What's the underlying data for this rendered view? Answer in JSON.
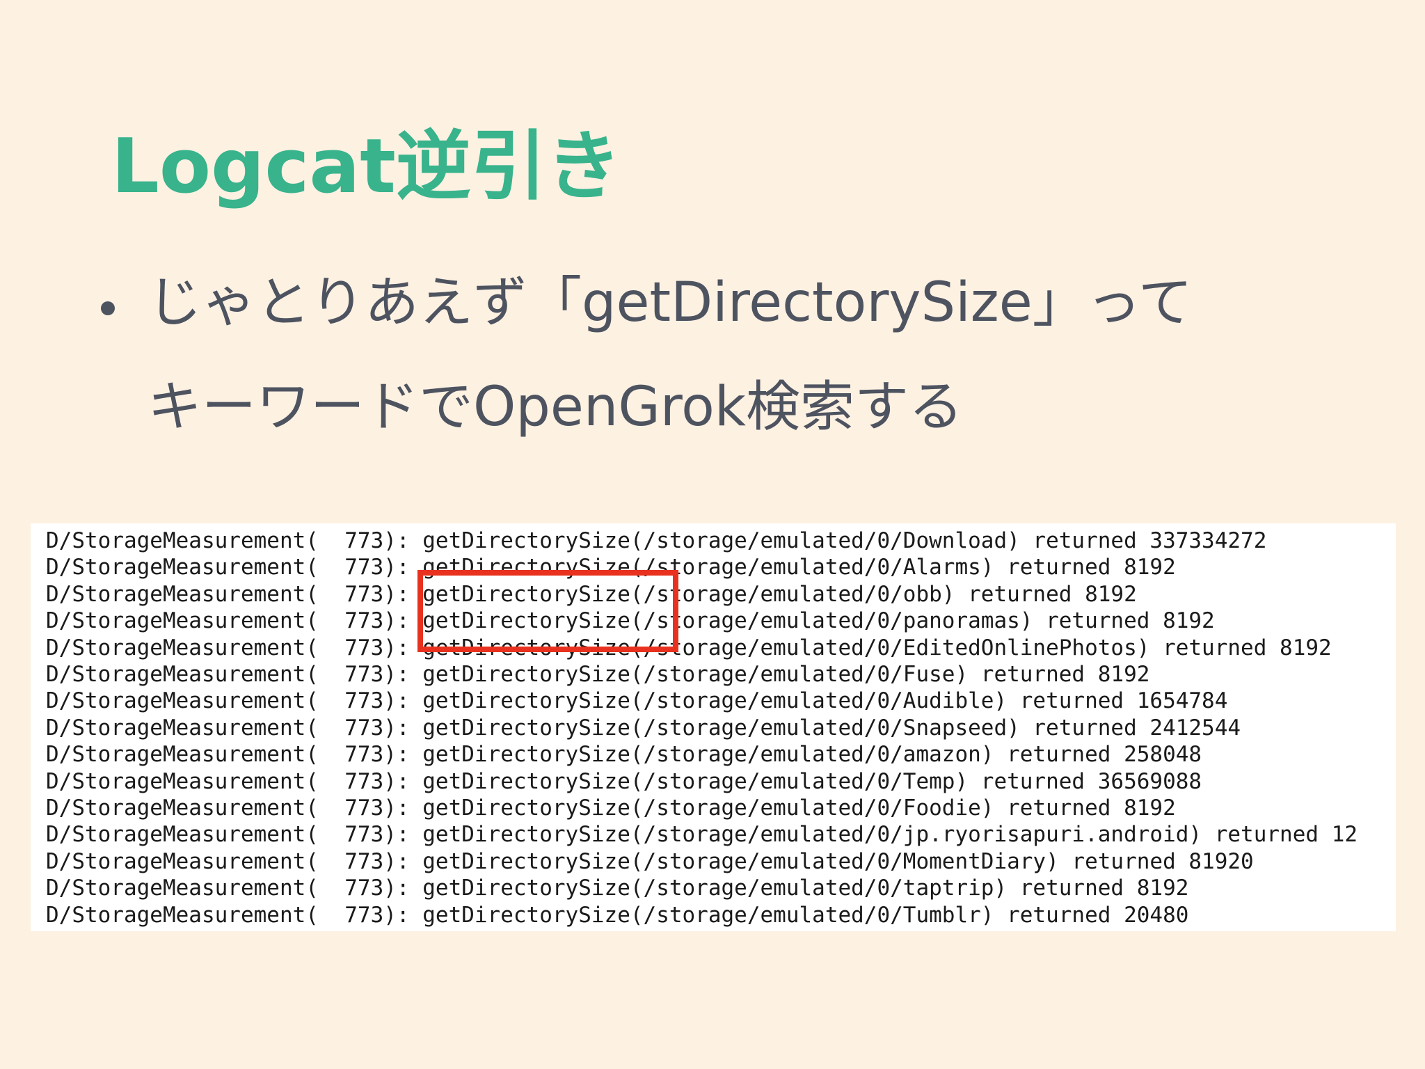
{
  "slide": {
    "title": "Logcat逆引き",
    "bullet": {
      "line1": "じゃとりあえず「getDirectorySize」って",
      "line2": "キーワードでOpenGrok検索する"
    }
  },
  "colors": {
    "background": "#fdf1e2",
    "title": "#38b38c",
    "body_text": "#4e5360",
    "highlight": "#e8321f"
  },
  "log": {
    "lines": [
      "D/StorageMeasurement(  773): getDirectorySize(/storage/emulated/0/Download) returned 337334272",
      "D/StorageMeasurement(  773): getDirectorySize(/storage/emulated/0/Alarms) returned 8192",
      "D/StorageMeasurement(  773): getDirectorySize(/storage/emulated/0/obb) returned 8192",
      "D/StorageMeasurement(  773): getDirectorySize(/storage/emulated/0/panoramas) returned 8192",
      "D/StorageMeasurement(  773): getDirectorySize(/storage/emulated/0/EditedOnlinePhotos) returned 8192",
      "D/StorageMeasurement(  773): getDirectorySize(/storage/emulated/0/Fuse) returned 8192",
      "D/StorageMeasurement(  773): getDirectorySize(/storage/emulated/0/Audible) returned 1654784",
      "D/StorageMeasurement(  773): getDirectorySize(/storage/emulated/0/Snapseed) returned 2412544",
      "D/StorageMeasurement(  773): getDirectorySize(/storage/emulated/0/amazon) returned 258048",
      "D/StorageMeasurement(  773): getDirectorySize(/storage/emulated/0/Temp) returned 36569088",
      "D/StorageMeasurement(  773): getDirectorySize(/storage/emulated/0/Foodie) returned 8192",
      "D/StorageMeasurement(  773): getDirectorySize(/storage/emulated/0/jp.ryorisapuri.android) returned 12",
      "D/StorageMeasurement(  773): getDirectorySize(/storage/emulated/0/MomentDiary) returned 81920",
      "D/StorageMeasurement(  773): getDirectorySize(/storage/emulated/0/taptrip) returned 8192",
      "D/StorageMeasurement(  773): getDirectorySize(/storage/emulated/0/Tumblr) returned 20480"
    ]
  }
}
